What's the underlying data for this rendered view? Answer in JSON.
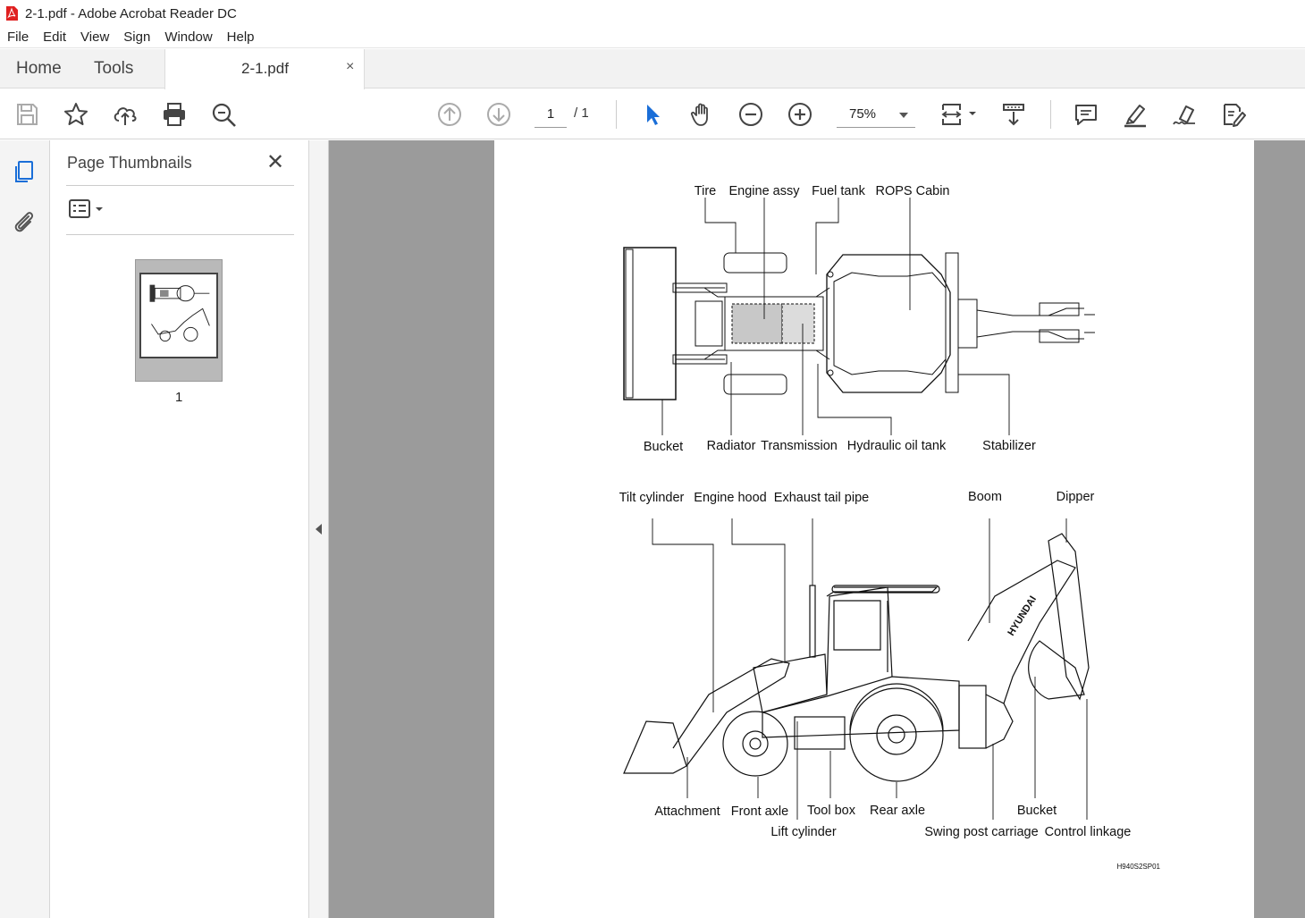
{
  "window": {
    "title": "2-1.pdf - Adobe Acrobat Reader DC"
  },
  "menu": [
    "File",
    "Edit",
    "View",
    "Sign",
    "Window",
    "Help"
  ],
  "tabs": {
    "home": "Home",
    "tools": "Tools",
    "document": "2-1.pdf",
    "close": "×"
  },
  "toolbar": {
    "page_current": "1",
    "page_total": "/   1",
    "zoom": "75%",
    "icons": [
      "save-icon",
      "star-icon",
      "upload-icon",
      "print-icon",
      "search-zoom-icon",
      "page-up-icon",
      "page-down-icon",
      "select-arrow-icon",
      "hand-icon",
      "zoom-out-icon",
      "zoom-in-icon",
      "fit-page-icon",
      "scroll-icon",
      "comment-icon",
      "highlight-icon",
      "sign-icon",
      "edit-pdf-icon"
    ]
  },
  "sidebar": {
    "title": "Page Thumbnails",
    "close": "✕",
    "thumbnail_label": "1"
  },
  "document": {
    "top_view_labels": {
      "tire": "Tire",
      "engine_assy": "Engine assy",
      "fuel_tank": "Fuel tank",
      "rops_cabin": "ROPS Cabin",
      "bucket": "Bucket",
      "radiator": "Radiator",
      "transmission": "Transmission",
      "hydraulic_oil_tank": "Hydraulic oil tank",
      "stabilizer": "Stabilizer"
    },
    "side_view_labels": {
      "tilt_cylinder": "Tilt cylinder",
      "engine_hood": "Engine hood",
      "exhaust_tail_pipe": "Exhaust tail pipe",
      "boom": "Boom",
      "dipper": "Dipper",
      "attachment": "Attachment",
      "front_axle": "Front axle",
      "tool_box": "Tool box",
      "rear_axle": "Rear axle",
      "bucket": "Bucket",
      "lift_cylinder": "Lift cylinder",
      "swing_post_carriage": "Swing post carriage",
      "control_linkage": "Control linkage"
    },
    "figure_code": "H940S2SP01",
    "brand_text": "HYUNDAI"
  }
}
